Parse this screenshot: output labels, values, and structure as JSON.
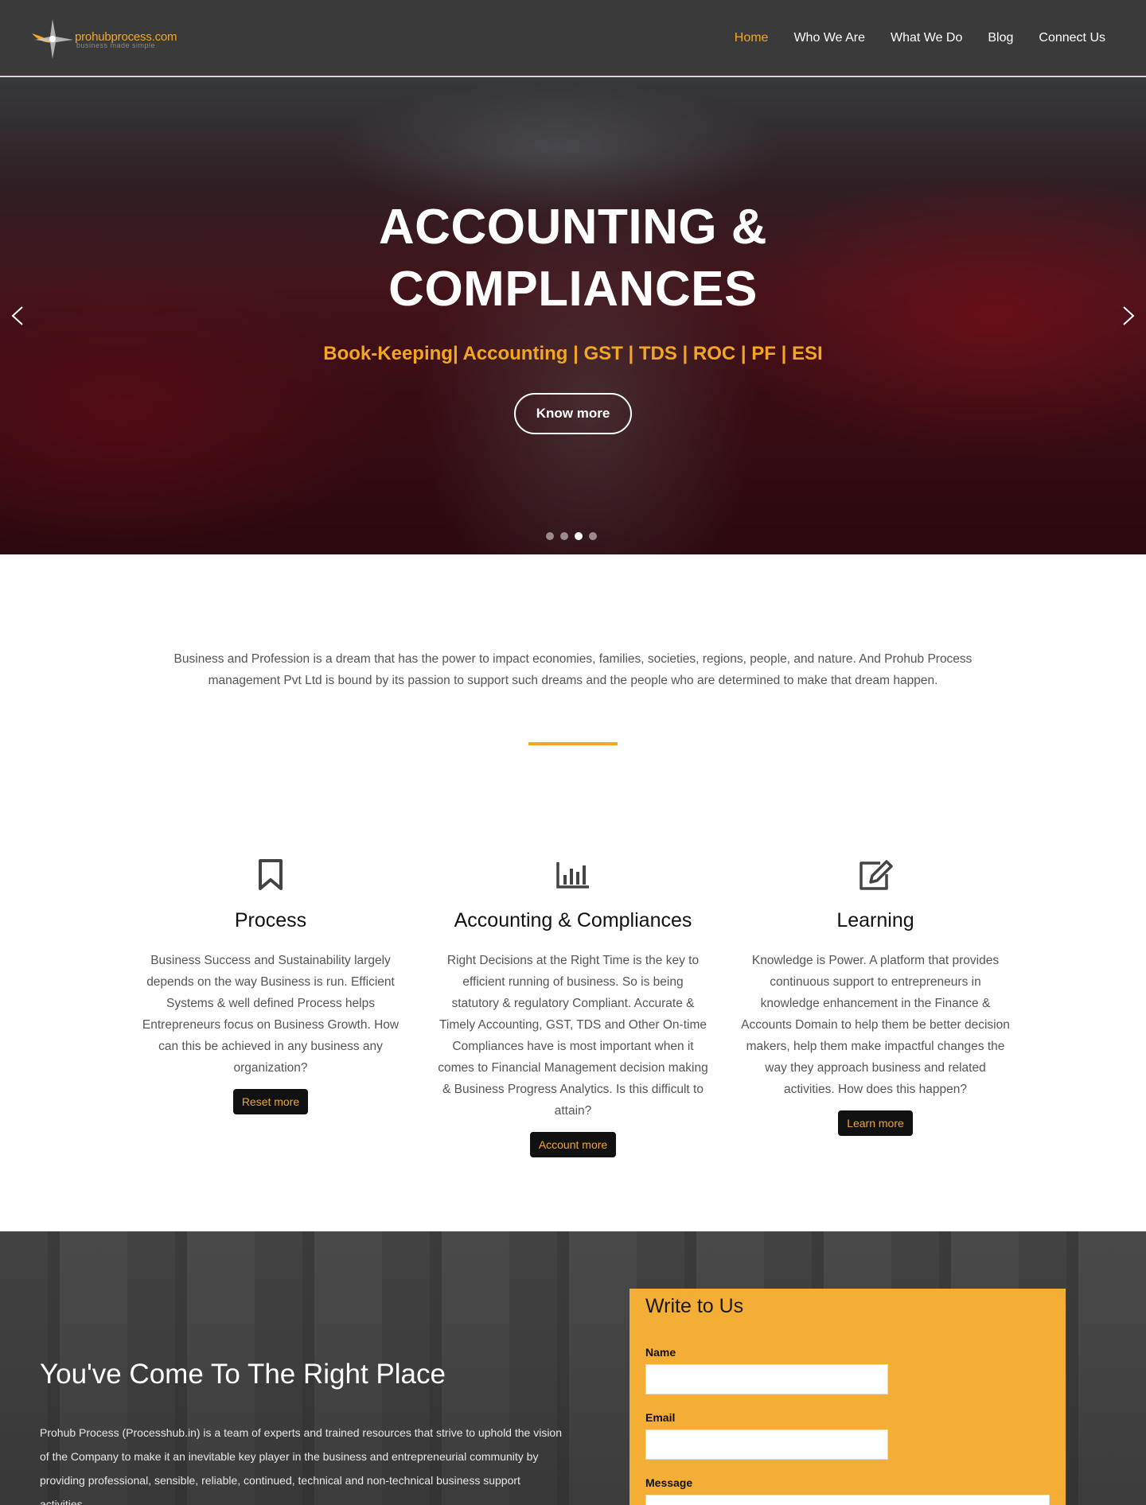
{
  "header": {
    "logo": {
      "name": "prohubprocess",
      "tld": ".com",
      "tagline": "business made simple"
    },
    "nav": [
      {
        "label": "Home",
        "active": true
      },
      {
        "label": "Who We Are",
        "active": false
      },
      {
        "label": "What We Do",
        "active": false
      },
      {
        "label": "Blog",
        "active": false
      },
      {
        "label": "Connect Us",
        "active": false
      }
    ]
  },
  "hero": {
    "title_line1": "ACCOUNTING &",
    "title_line2": "COMPLIANCES",
    "subtitle": "Book-Keeping| Accounting | GST | TDS | ROC | PF | ESI",
    "button": "Know more",
    "slides": 4,
    "active_slide": 3
  },
  "intro": {
    "text": "Business and Profession is a dream that has the power to impact economies, families, societies, regions, people, and nature. And Prohub Process management Pvt Ltd is bound by its passion to support such dreams and the people who are determined to make that dream happen."
  },
  "features": [
    {
      "icon": "bookmark-icon",
      "title": "Process",
      "text": "Business Success and Sustainability largely depends on the way Business is run. Efficient Systems & well defined Process helps Entrepreneurs focus on Business Growth. How can this be achieved in any business any organization?",
      "button": "Reset more"
    },
    {
      "icon": "bar-chart-icon",
      "title": "Accounting & Compliances",
      "text": "Right Decisions at the Right Time is the key to efficient running of business. So is being statutory & regulatory Compliant. Accurate & Timely Accounting, GST, TDS and Other On-time Compliances have is most important when it comes to Financial Management decision making & Business Progress Analytics. Is this difficult to attain?",
      "button": "Account more"
    },
    {
      "icon": "edit-icon",
      "title": "Learning",
      "text": "Knowledge is Power. A platform that provides continuous support to entrepreneurs in knowledge enhancement in the Finance & Accounts Domain to help them be better decision makers, help them make impactful changes the way they approach business and related activities. How does this happen?",
      "button": "Learn more"
    }
  ],
  "bottom": {
    "title": "You've Come To The Right Place",
    "text": "Prohub Process (Processhub.in) is a team of experts and trained resources that strive to uphold the vision of the Company to make it an inevitable key player in the business and entrepreneurial community by providing professional, sensible, reliable, continued, technical and non-technical business support activities."
  },
  "form": {
    "title": "Write to Us",
    "name_label": "Name",
    "email_label": "Email",
    "message_label": "Message"
  },
  "colors": {
    "accent": "#f4a623",
    "header_bg": "#3a3a3a",
    "button_bg": "#111111",
    "form_bg": "#f4ae35"
  }
}
